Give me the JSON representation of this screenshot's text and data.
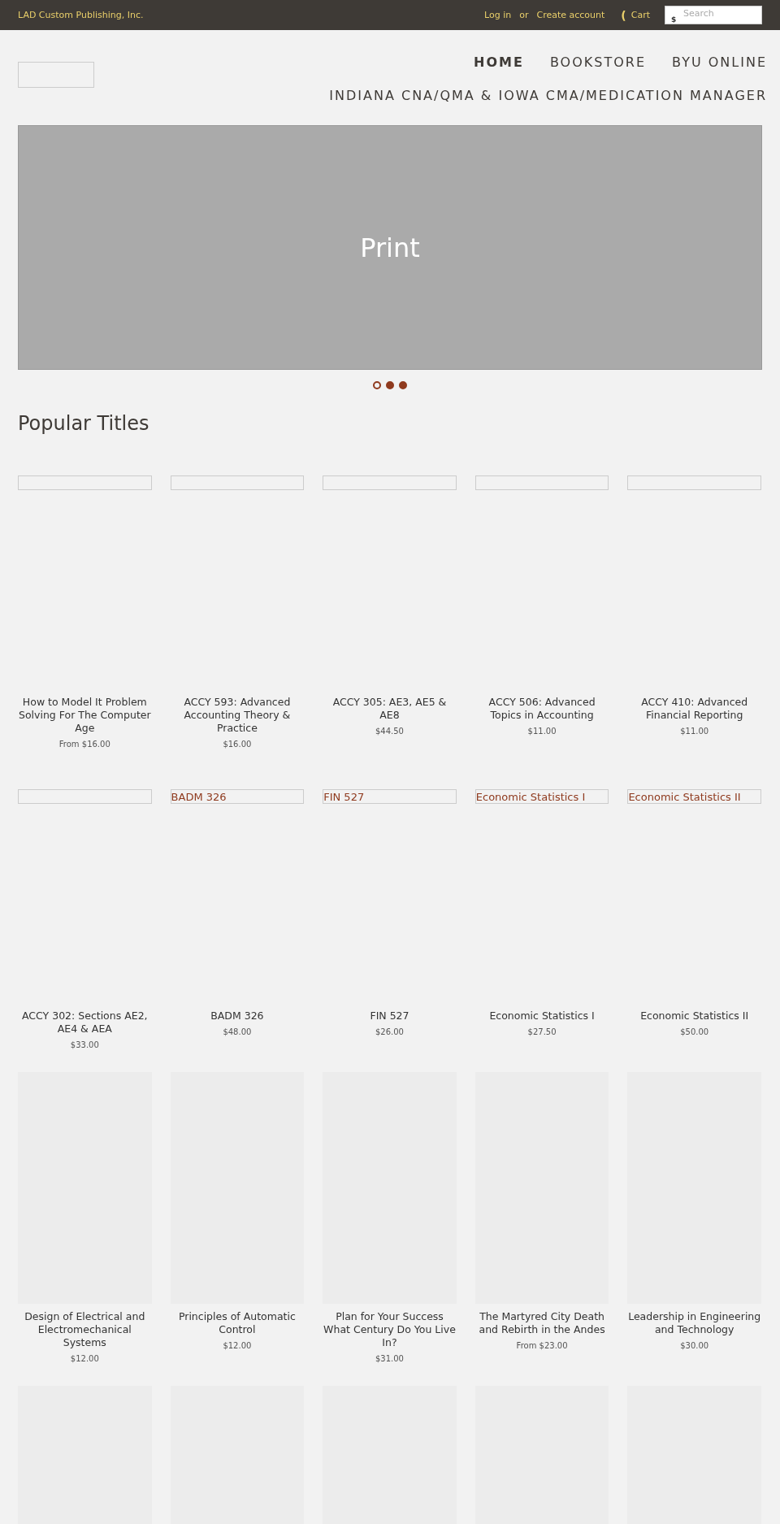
{
  "top_bar": {
    "company": "LAD Custom Publishing, Inc.",
    "login": "Log in",
    "or": "or",
    "create_account": "Create account",
    "cart_icon": "(",
    "cart": "Cart",
    "search": {
      "placeholder": "Search",
      "currency": "$"
    }
  },
  "nav": {
    "items": [
      {
        "label": "HOME",
        "selected": true
      },
      {
        "label": "BOOKSTORE",
        "selected": false
      },
      {
        "label": "BYU ONLINE",
        "selected": false
      },
      {
        "label": "INDIANA CNA/QMA & IOWA CMA/MEDICATION MANAGER",
        "selected": false
      }
    ]
  },
  "slideshow": {
    "caption": "Print",
    "dots": [
      {
        "selected": true
      },
      {
        "selected": false
      },
      {
        "selected": false
      }
    ]
  },
  "section_title": "Popular Titles",
  "products": [
    {
      "kind": "broken",
      "title": "How to Model It Problem Solving For The Computer Age",
      "price": "From $16.00"
    },
    {
      "kind": "broken",
      "title": "ACCY 593: Advanced Accounting Theory & Practice",
      "price": "$16.00"
    },
    {
      "kind": "broken",
      "title": "ACCY 305: AE3, AE5 & AE8",
      "price": "$44.50"
    },
    {
      "kind": "broken",
      "title": "ACCY 506: Advanced Topics in Accounting",
      "price": "$11.00"
    },
    {
      "kind": "broken",
      "title": "ACCY 410: Advanced Financial Reporting",
      "price": "$11.00"
    },
    {
      "kind": "broken",
      "title": "ACCY 302: Sections AE2, AE4 & AEA",
      "price": "$33.00"
    },
    {
      "kind": "broken",
      "alt": "BADM 326",
      "title": "BADM 326",
      "price": "$48.00"
    },
    {
      "kind": "broken",
      "alt": "FIN 527",
      "title": "FIN 527",
      "price": "$26.00"
    },
    {
      "kind": "broken",
      "alt": "Economic Statistics I",
      "title": "Economic Statistics I",
      "price": "$27.50"
    },
    {
      "kind": "broken",
      "alt": "Economic Statistics II",
      "title": "Economic Statistics II",
      "price": "$50.00"
    },
    {
      "kind": "placeholder",
      "title": "Design of Electrical and Electromechanical Systems",
      "price": "$12.00"
    },
    {
      "kind": "placeholder",
      "title": "Principles of Automatic Control",
      "price": "$12.00"
    },
    {
      "kind": "placeholder",
      "title": "Plan for Your Success What Century Do You Live In?",
      "price": "$31.00"
    },
    {
      "kind": "placeholder",
      "title": "The Martyred City Death and Rebirth in the Andes",
      "price": "From $23.00"
    },
    {
      "kind": "placeholder",
      "title": "Leadership in Engineering and Technology",
      "price": "$30.00"
    },
    {
      "kind": "placeholder"
    },
    {
      "kind": "placeholder"
    },
    {
      "kind": "placeholder"
    },
    {
      "kind": "placeholder"
    },
    {
      "kind": "placeholder"
    }
  ]
}
